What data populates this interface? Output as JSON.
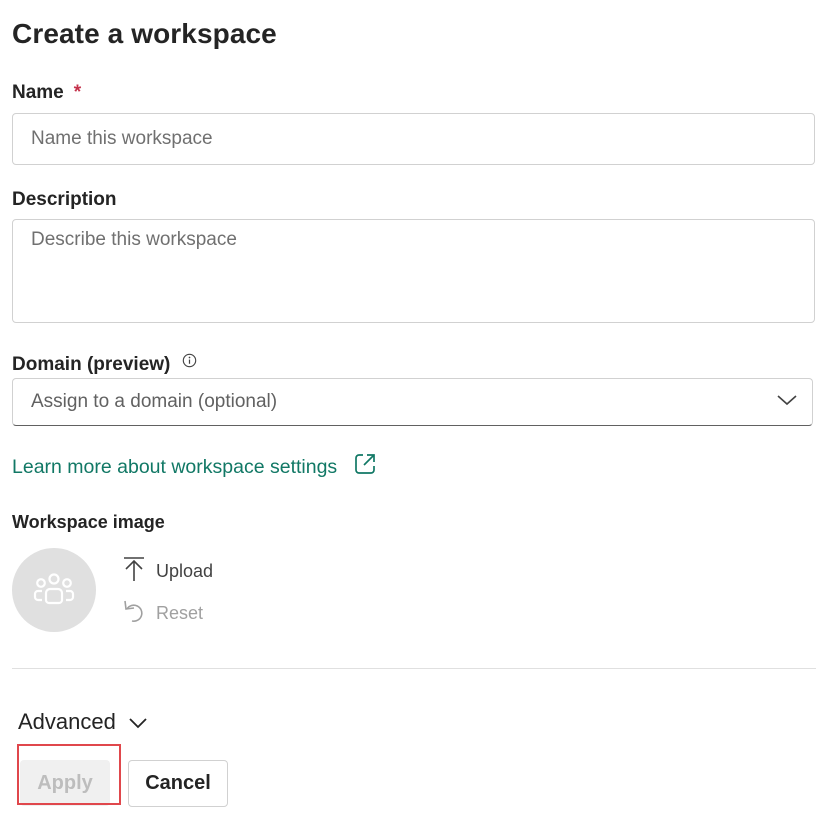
{
  "page": {
    "title": "Create a workspace"
  },
  "name_field": {
    "label": "Name",
    "required_mark": "*",
    "value": "",
    "placeholder": "Name this workspace"
  },
  "description_field": {
    "label": "Description",
    "value": "",
    "placeholder": "Describe this workspace"
  },
  "domain_field": {
    "label": "Domain (preview)",
    "info_icon": "info-icon",
    "selected_text": "Assign to a domain (optional)",
    "dropdown_icon": "chevron-down-icon"
  },
  "learn_more": {
    "label": "Learn more about workspace settings",
    "icon": "external-link-icon"
  },
  "workspace_image": {
    "label": "Workspace image",
    "avatar_icon": "people-group-icon",
    "upload_label": "Upload",
    "reset_label": "Reset"
  },
  "advanced": {
    "label": "Advanced",
    "icon": "chevron-down-icon"
  },
  "footer": {
    "apply_label": "Apply",
    "cancel_label": "Cancel"
  },
  "colors": {
    "link": "#117865",
    "required": "#c4314b",
    "highlight": "#e0474c",
    "disabled_text": "#bdbdbd",
    "avatar_bg": "#e0e0e0"
  }
}
